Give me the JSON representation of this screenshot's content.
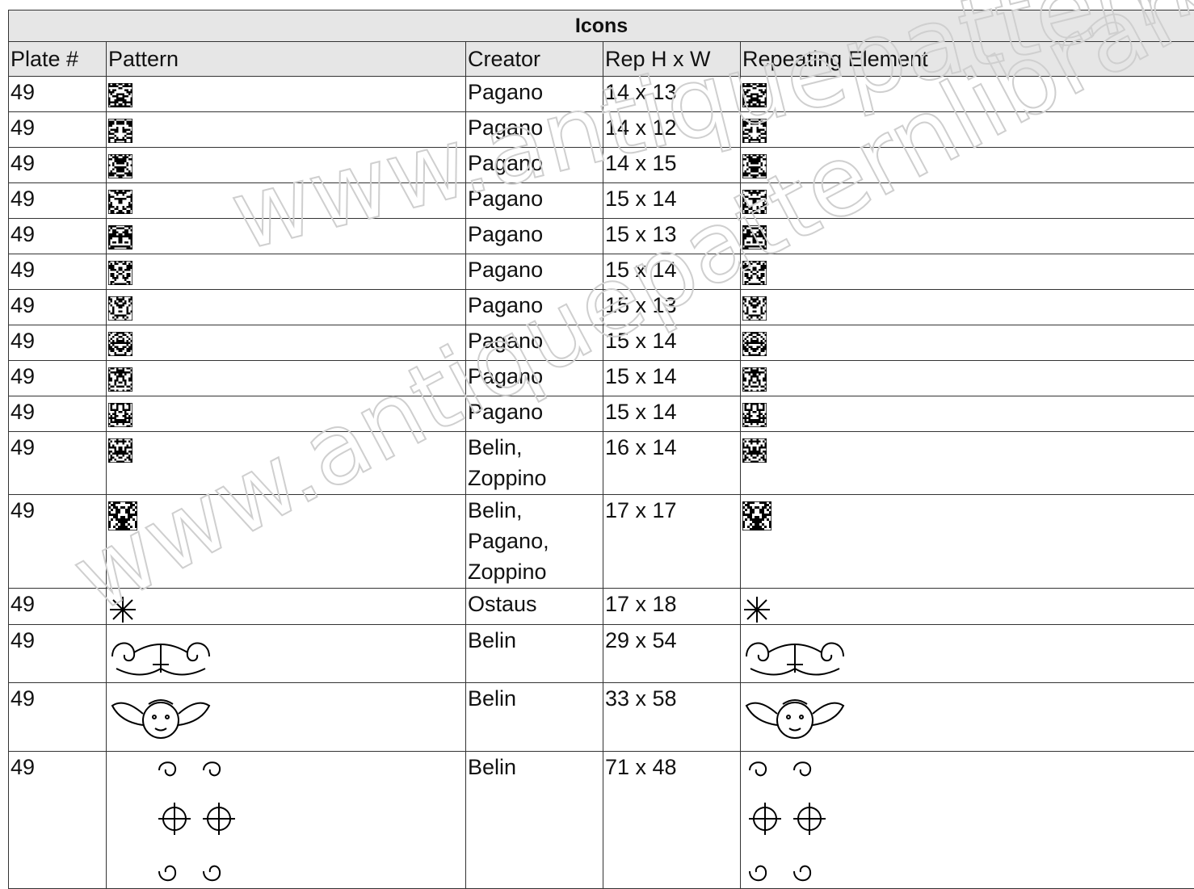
{
  "table": {
    "title": "Icons",
    "headers": [
      "Plate #",
      "Pattern",
      "Creator",
      "Rep H x W",
      "Repeating Element"
    ],
    "rows": [
      {
        "plate": "49",
        "creator": "Pagano",
        "rep": "14 x 13",
        "icon": "cross-stitch-motif-1-icon"
      },
      {
        "plate": "49",
        "creator": "Pagano",
        "rep": "14 x 12",
        "icon": "cross-stitch-motif-2-icon"
      },
      {
        "plate": "49",
        "creator": "Pagano",
        "rep": "14 x 15",
        "icon": "cross-stitch-motif-3-icon"
      },
      {
        "plate": "49",
        "creator": "Pagano",
        "rep": "15 x 14",
        "icon": "cross-stitch-motif-4-icon"
      },
      {
        "plate": "49",
        "creator": "Pagano",
        "rep": "15 x 13",
        "icon": "cross-stitch-motif-5-icon"
      },
      {
        "plate": "49",
        "creator": "Pagano",
        "rep": "15 x 14",
        "icon": "cross-stitch-motif-6-icon"
      },
      {
        "plate": "49",
        "creator": "Pagano",
        "rep": "15 x 13",
        "icon": "cross-stitch-motif-7-icon"
      },
      {
        "plate": "49",
        "creator": "Pagano",
        "rep": "15 x 14",
        "icon": "cross-stitch-motif-8-icon"
      },
      {
        "plate": "49",
        "creator": "Pagano",
        "rep": "15 x 14",
        "icon": "cross-stitch-motif-9-icon"
      },
      {
        "plate": "49",
        "creator": "Pagano",
        "rep": "15 x 14",
        "icon": "cross-stitch-motif-10-icon"
      },
      {
        "plate": "49",
        "creator": "Belin, Zoppino",
        "rep": "16 x 14",
        "icon": "fleur-de-lis-motif-icon"
      },
      {
        "plate": "49",
        "creator": "Belin, Pagano, Zoppino",
        "rep": "17 x 17",
        "icon": "animal-pair-motif-icon"
      },
      {
        "plate": "49",
        "creator": "Ostaus",
        "rep": "17 x 18",
        "icon": "starburst-motif-icon"
      },
      {
        "plate": "49",
        "creator": "Belin",
        "rep": "29 x 54",
        "icon": "scroll-vine-border-icon"
      },
      {
        "plate": "49",
        "creator": "Belin",
        "rep": "33 x 58",
        "icon": "winged-cherub-motif-icon"
      },
      {
        "plate": "49",
        "creator": "Belin",
        "rep": "71 x 48",
        "icon": "floral-scroll-panel-icon"
      }
    ]
  },
  "watermark": {
    "text": "www.antiquepatternlibrary.org"
  }
}
